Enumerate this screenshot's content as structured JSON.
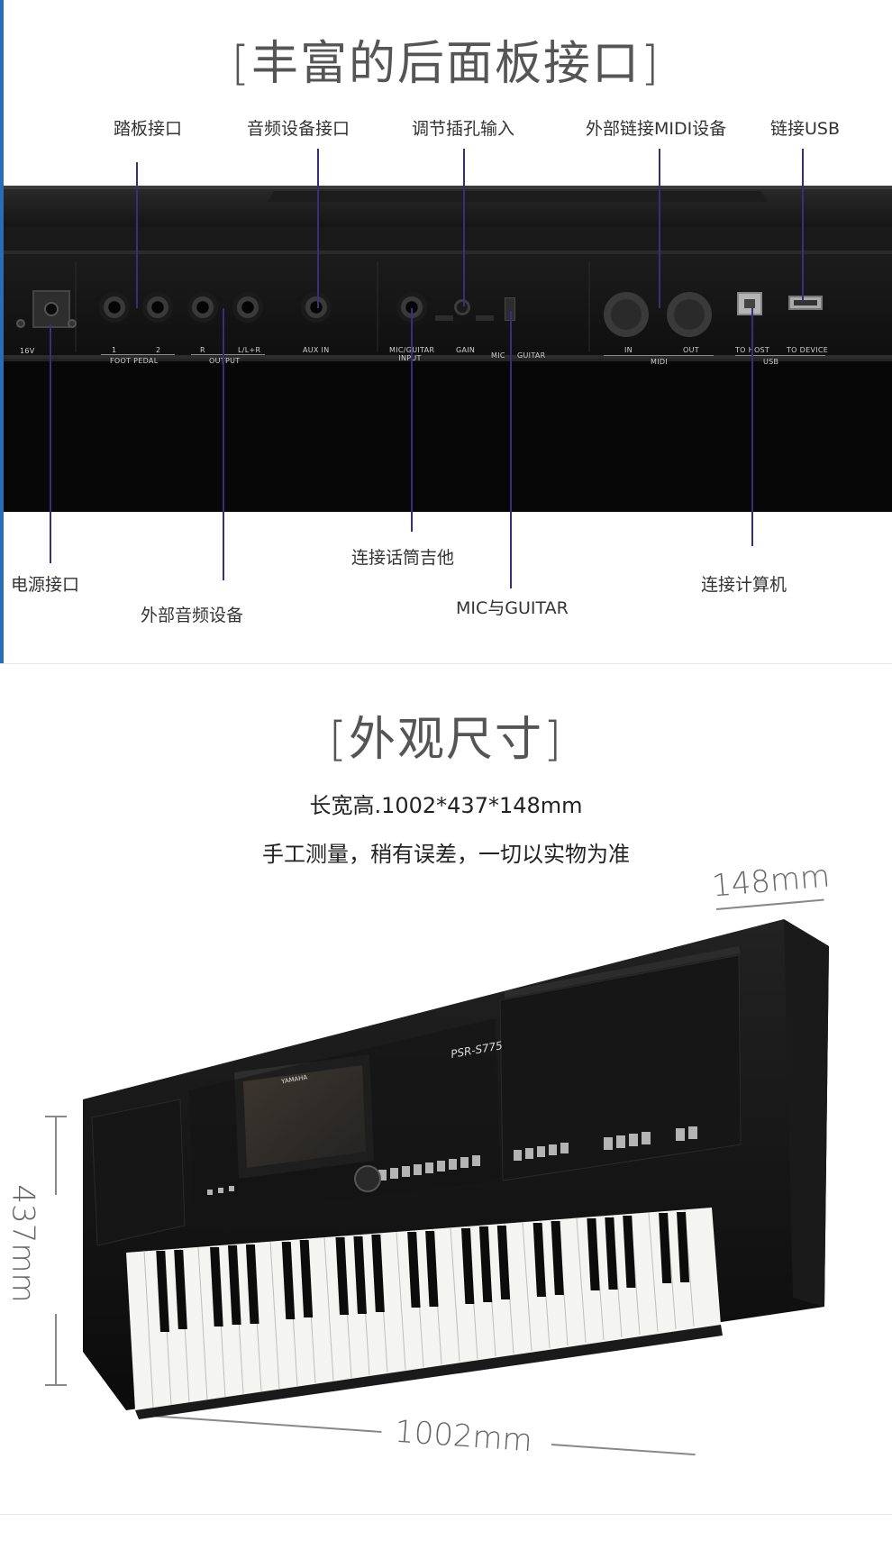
{
  "section1": {
    "title": "[丰富的后面板接口]",
    "labels_top": {
      "pedal": "踏板接口",
      "audio_device": "音频设备接口",
      "gain_input": "调节插孔输入",
      "midi_device": "外部链接MIDI设备",
      "usb": "链接USB"
    },
    "labels_bottom": {
      "power": "电源接口",
      "external_audio": "外部音频设备",
      "mic_guitar_connect": "连接话筒吉他",
      "mic_guitar": "MIC与GUITAR",
      "computer": "连接计算机"
    },
    "panel_labels": {
      "dc_in": "16V",
      "foot_1": "1",
      "foot_2": "2",
      "foot_pedal": "FOOT PEDAL",
      "out_r": "R",
      "out_l": "L/L+R",
      "output": "OUTPUT",
      "aux_in": "AUX IN",
      "mic_input": "MIC/GUITAR INPUT",
      "gain": "GAIN",
      "mic_switch": "MIC",
      "guitar_switch": "GUITAR",
      "midi_in": "IN",
      "midi_out": "OUT",
      "midi": "MIDI",
      "to_host": "TO HOST",
      "to_device": "TO DEVICE",
      "usb": "USB"
    }
  },
  "section2": {
    "title": "[外观尺寸]",
    "line1": "长宽高.1002*437*148mm",
    "line2": "手工测量，稍有误差，一切以实物为准",
    "depth": "148mm",
    "height": "437mm",
    "width": "1002mm",
    "brand": "YAMAHA",
    "model": "PSR-S775"
  }
}
